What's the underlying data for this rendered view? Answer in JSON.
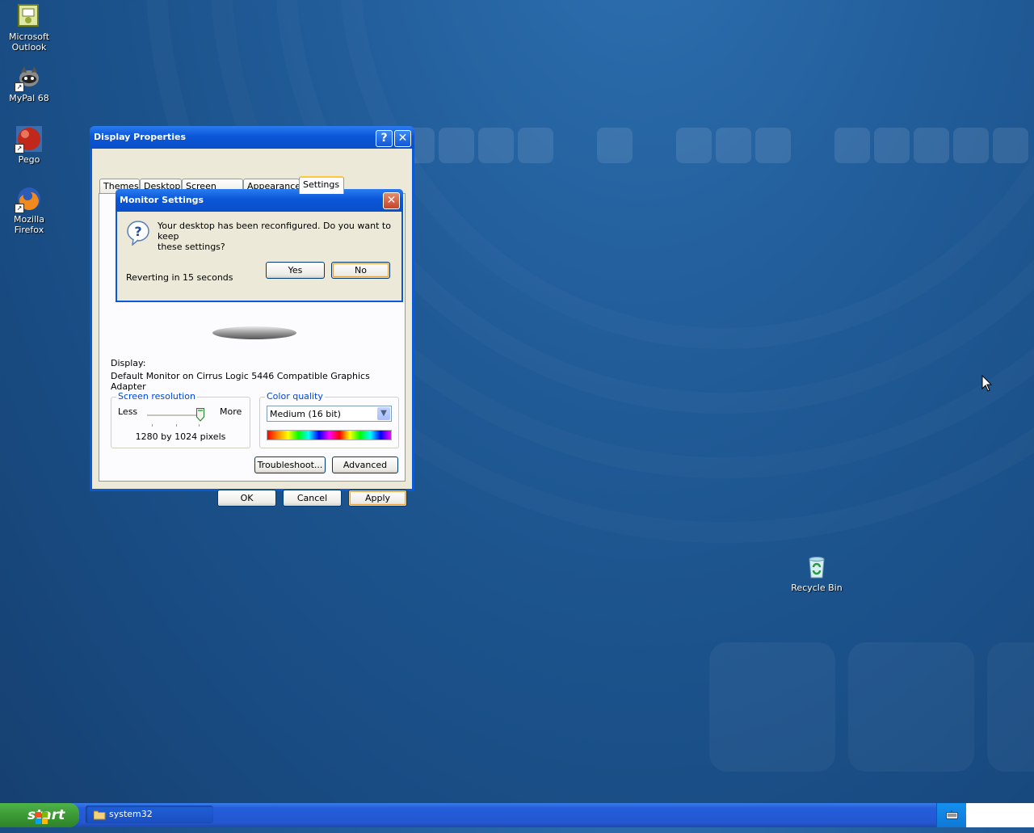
{
  "desktop": {
    "icons": [
      {
        "label_line1": "Microsoft",
        "label_line2": "Outlook"
      },
      {
        "label_line1": "MyPal 68"
      },
      {
        "label_line1": "Pego"
      },
      {
        "label_line1": "Mozilla Firefox"
      },
      {
        "label_line1": "Recycle Bin"
      }
    ]
  },
  "display_properties": {
    "title": "Display Properties",
    "help_glyph": "?",
    "close_glyph": "✕",
    "tabs": [
      {
        "label": "Themes"
      },
      {
        "label": "Desktop"
      },
      {
        "label": "Screen Saver"
      },
      {
        "label": "Appearance"
      },
      {
        "label": "Settings"
      }
    ],
    "active_tab": "Settings",
    "display_label": "Display:",
    "display_value": "Default Monitor on Cirrus Logic 5446 Compatible Graphics Adapter",
    "screen_resolution": {
      "legend": "Screen resolution",
      "less": "Less",
      "more": "More",
      "value": "1280 by 1024 pixels",
      "slider_fraction": 1.0
    },
    "color_quality": {
      "legend": "Color quality",
      "selected": "Medium (16 bit)"
    },
    "buttons": {
      "troubleshoot": "Troubleshoot...",
      "advanced": "Advanced",
      "ok": "OK",
      "cancel": "Cancel",
      "apply": "Apply"
    }
  },
  "monitor_settings": {
    "title": "Monitor Settings",
    "close_glyph": "✕",
    "message_line1": "Your desktop has been reconfigured.  Do you want to keep",
    "message_line2": "these settings?",
    "countdown": "Reverting in 15 seconds",
    "yes": "Yes",
    "no": "No"
  },
  "taskbar": {
    "start_label": "start",
    "task": "system32"
  },
  "colors": {
    "title_blue": "#0a5ad6",
    "dialog_face": "#ece9d8",
    "group_legend": "#0046d5",
    "start_green": "#3c9a36"
  }
}
